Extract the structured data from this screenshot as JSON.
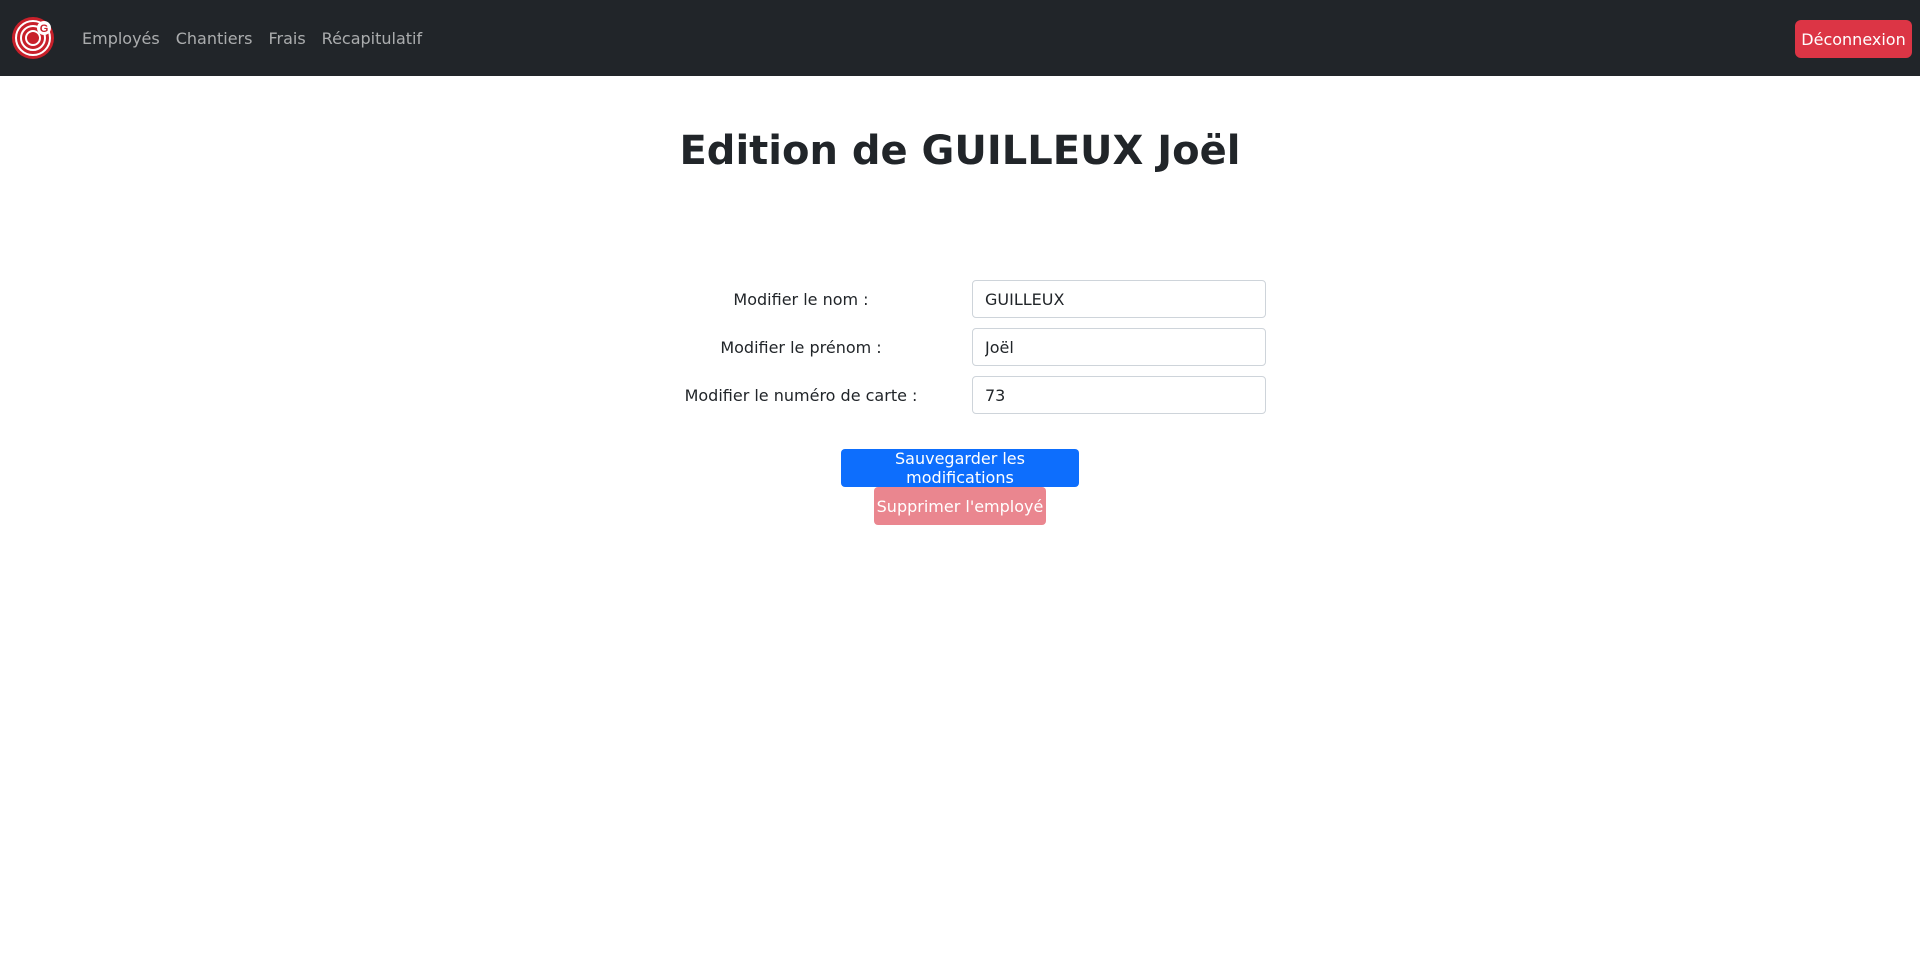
{
  "nav": {
    "items": [
      {
        "label": "Employés"
      },
      {
        "label": "Chantiers"
      },
      {
        "label": "Frais"
      },
      {
        "label": "Récapitulatif"
      }
    ],
    "logout_label": "Déconnexion",
    "logo_letter": "G"
  },
  "page": {
    "title": "Edition de GUILLEUX Joël"
  },
  "form": {
    "fields": [
      {
        "label": "Modifier le nom :",
        "value": "GUILLEUX"
      },
      {
        "label": "Modifier le prénom :",
        "value": "Joël"
      },
      {
        "label": "Modifier le numéro de carte :",
        "value": "73"
      }
    ],
    "save_label": "Sauvegarder les modifications",
    "delete_label": "Supprimer l'employé"
  },
  "colors": {
    "navbar_bg": "#212529",
    "primary": "#0d6efd",
    "danger": "#dc3545",
    "danger_light": "#ea868f"
  }
}
